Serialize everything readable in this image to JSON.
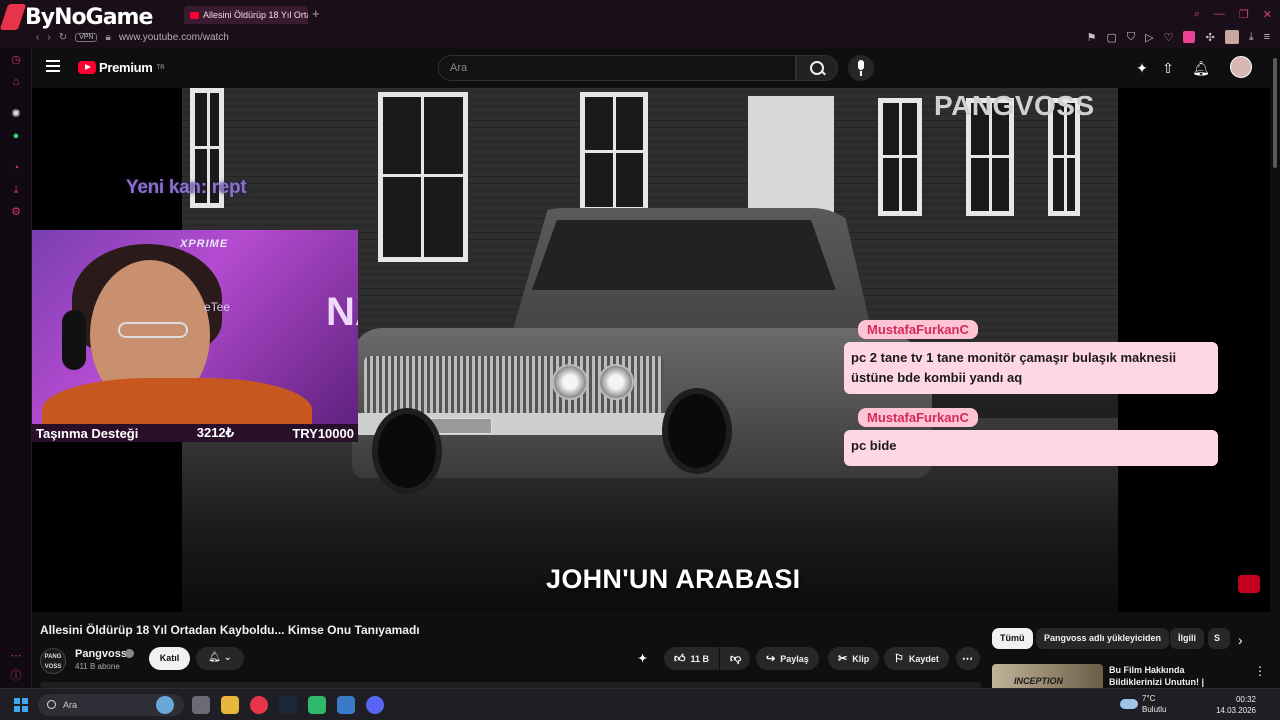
{
  "browser": {
    "brand": "ByNoGame",
    "tab_title": "Allesini Öldürüp 18 Yıl Orta",
    "new_tab": "+",
    "vpn_badge": "VPN",
    "url": "www.youtube.com/watch"
  },
  "youtube": {
    "logo_text": "Premium",
    "logo_region": "TR",
    "search_placeholder": "Ara",
    "video": {
      "channel_watermark": "PANGVOSS",
      "caption": "JOHN'UN ARABASI"
    },
    "title": "Allesini Öldürüp 18 Yıl Ortadan Kayboldu... Kimse Onu Tanıyamadı",
    "channel": {
      "avatar_text": "PANG VOSS",
      "name": "Pangvoss",
      "subscribers": "411 B abone",
      "join_label": "Katıl"
    },
    "actions": {
      "likes": "11 B",
      "share": "Paylaş",
      "clip": "Klip",
      "save": "Kaydet"
    },
    "chips": [
      {
        "label": "Tümü",
        "active": true
      },
      {
        "label": "Pangvoss adlı yükleyiciden",
        "active": false
      },
      {
        "label": "İlgili",
        "active": false
      },
      {
        "label": "S",
        "active": false
      }
    ],
    "recommendation": {
      "thumb_text": "INCEPTION",
      "title": "Bu Film Hakkında Bildiklerinizi Unutun! | INCEPTION Detaylı ..."
    }
  },
  "stream_overlay": {
    "scroll_text": "Yeni kan: rept",
    "cam_brand": "XPRIME",
    "cam_name": "eTee",
    "cam_neon": "NA",
    "donation_label": "Taşınma Desteği",
    "donation_amount": "3212₺",
    "donation_goal": "TRY10000",
    "chat": [
      {
        "user": "MustafaFurkanC",
        "message_line1": "pc 2 tane tv 1 tane monitör çamaşır bulaşık maknesii",
        "message_line2": "üstüne bde kombii yandı aq"
      },
      {
        "user": "MustafaFurkanC",
        "message_line1": "pc bide",
        "message_line2": ""
      }
    ]
  },
  "taskbar": {
    "search_placeholder": "Ara",
    "weather_temp": "7°C",
    "weather_desc": "Bulutlu",
    "time": "00:32",
    "date": "14.03.2026"
  },
  "colors": {
    "accent_red": "#ff0033",
    "chat_user": "#d42a5a",
    "chat_bg": "#ffd6e5"
  }
}
